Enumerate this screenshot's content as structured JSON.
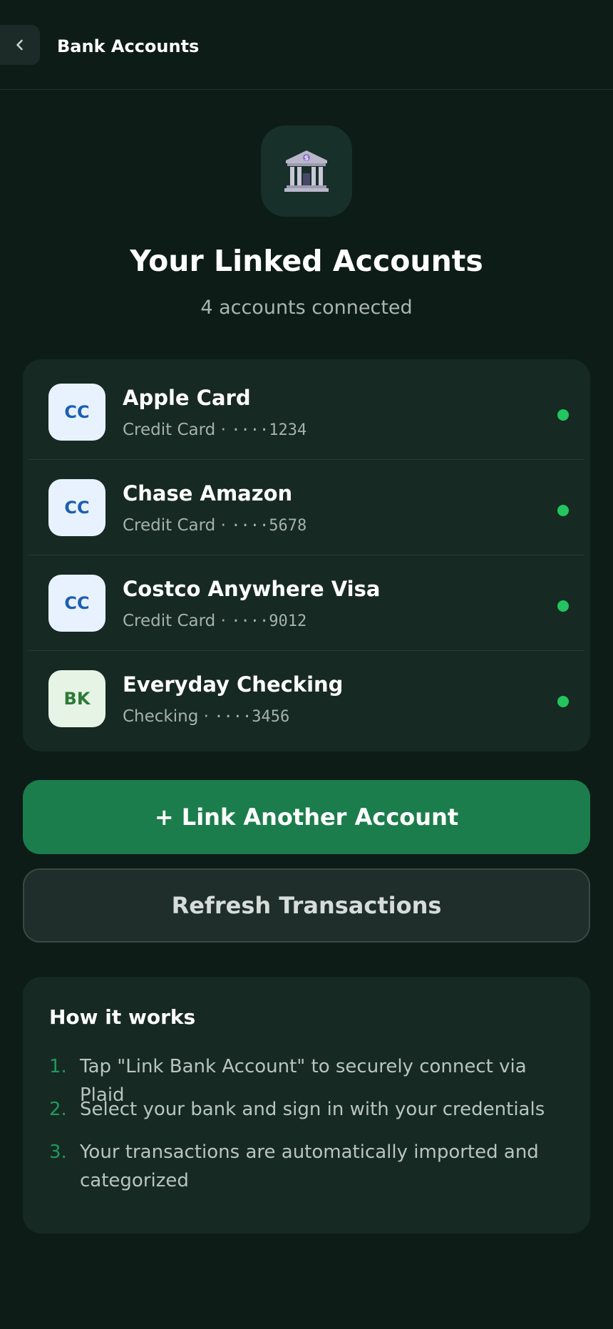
{
  "header": {
    "title": "Bank Accounts"
  },
  "hero": {
    "icon": "bank-building-icon",
    "title": "Your Linked Accounts",
    "subtitle": "4 accounts connected"
  },
  "accounts": [
    {
      "badge": "CC",
      "name": "Apple Card",
      "type": "Credit Card",
      "separator": " · ",
      "mask": "····1234",
      "status": "connected"
    },
    {
      "badge": "CC",
      "name": "Chase Amazon",
      "type": "Credit Card",
      "separator": " · ",
      "mask": "····5678",
      "status": "connected"
    },
    {
      "badge": "CC",
      "name": "Costco Anywhere Visa",
      "type": "Credit Card",
      "separator": " · ",
      "mask": "····9012",
      "status": "connected"
    },
    {
      "badge": "BK",
      "name": "Everyday Checking",
      "type": "Checking",
      "separator": " · ",
      "mask": "····3456",
      "status": "connected"
    }
  ],
  "actions": {
    "link_label": "+ Link Another Account",
    "refresh_label": "Refresh Transactions"
  },
  "how_it_works": {
    "title": "How it works",
    "steps": [
      {
        "num": "1.",
        "text": "Tap \"Link Bank Account\" to securely connect via Plaid"
      },
      {
        "num": "2.",
        "text": "Select your bank and sign in with your credentials"
      },
      {
        "num": "3.",
        "text": "Your transactions are automatically imported and categorized"
      }
    ]
  },
  "colors": {
    "background": "#0e1c18",
    "card": "#172923",
    "accent": "#1b7d4b",
    "status_connected": "#22c55e"
  }
}
